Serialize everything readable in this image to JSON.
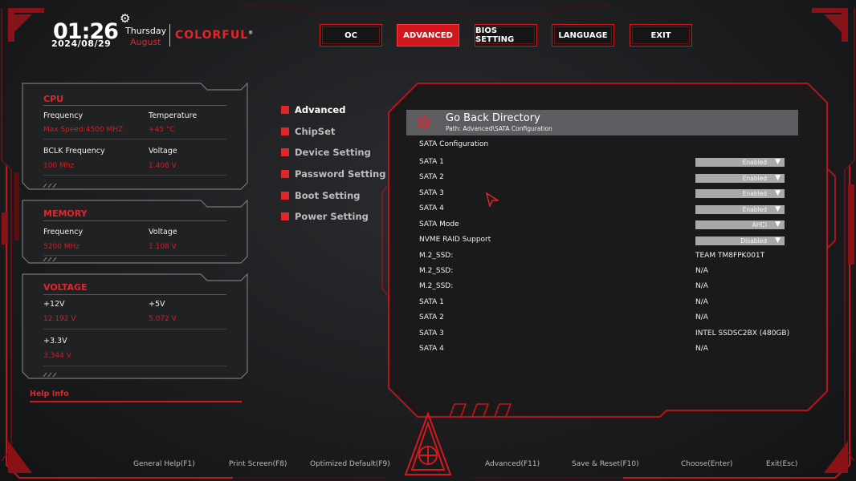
{
  "header": {
    "time": "01:26",
    "weekday": "Thursday",
    "date": "2024/08/29",
    "month": "August",
    "brand": "COLORFUL",
    "brand_mark": "®"
  },
  "nav": {
    "tabs": [
      {
        "label": "OC",
        "active": false
      },
      {
        "label": "ADVANCED",
        "active": true
      },
      {
        "label": "BIOS SETTING",
        "active": false
      },
      {
        "label": "LANGUAGE",
        "active": false
      },
      {
        "label": "EXIT",
        "active": false
      }
    ]
  },
  "cpu": {
    "title": "CPU",
    "frequency_label": "Frequency",
    "frequency_value": "Max Speed:4500 MHZ",
    "temperature_label": "Temperature",
    "temperature_value": "+45 °C",
    "bclk_label": "BCLK Frequency",
    "bclk_value": "100 Mhz",
    "voltage_label": "Voltage",
    "voltage_value": "1.408 V"
  },
  "memory": {
    "title": "MEMORY",
    "frequency_label": "Frequency",
    "frequency_value": "5200 MHz",
    "voltage_label": "Voltage",
    "voltage_value": "1.108 V"
  },
  "voltage": {
    "title": "VOLTAGE",
    "v12_label": "+12V",
    "v12_value": "12.192 V",
    "v5_label": "+5V",
    "v5_value": "5.072 V",
    "v33_label": "+3.3V",
    "v33_value": "3.344 V"
  },
  "help": {
    "label": "Help Info"
  },
  "menu": {
    "items": [
      {
        "label": "Advanced",
        "active": true
      },
      {
        "label": "ChipSet",
        "active": false
      },
      {
        "label": "Device Setting",
        "active": false
      },
      {
        "label": "Password Setting",
        "active": false
      },
      {
        "label": "Boot Setting",
        "active": false
      },
      {
        "label": "Power Setting",
        "active": false
      }
    ]
  },
  "main": {
    "goback_title": "Go Back Directory",
    "goback_path": "Path: Advanced\\SATA Configuration",
    "section_title": "SATA Configuration",
    "settings": [
      {
        "label": "SATA 1",
        "value": "Enabled"
      },
      {
        "label": "SATA 2",
        "value": "Enabled"
      },
      {
        "label": "SATA 3",
        "value": "Enabled"
      },
      {
        "label": "SATA 4",
        "value": "Enabled"
      },
      {
        "label": "SATA Mode",
        "value": "AHCI"
      },
      {
        "label": "NVME RAID Support",
        "value": "Disabled"
      }
    ],
    "devices": [
      {
        "label": "M.2_SSD:",
        "value": "TEAM TM8FPK001T"
      },
      {
        "label": "M.2_SSD:",
        "value": "N/A"
      },
      {
        "label": "M.2_SSD:",
        "value": "N/A"
      },
      {
        "label": "SATA 1",
        "value": "N/A"
      },
      {
        "label": "SATA 2",
        "value": "N/A"
      },
      {
        "label": "SATA 3",
        "value": "INTEL SSDSC2BX (480GB)"
      },
      {
        "label": "SATA 4",
        "value": "N/A"
      }
    ]
  },
  "footer": {
    "items": [
      "General Help(F1)",
      "Print Screen(F8)",
      "Optimized Default(F9)",
      "Advanced(F11)",
      "Save & Reset(F10)",
      "Choose(Enter)",
      "Exit(Esc)"
    ]
  },
  "colors": {
    "accent": "#e0262b",
    "background": "#1b1c1e",
    "dropdown": "#a9a9a9",
    "goback_bar": "#5c5d60"
  }
}
